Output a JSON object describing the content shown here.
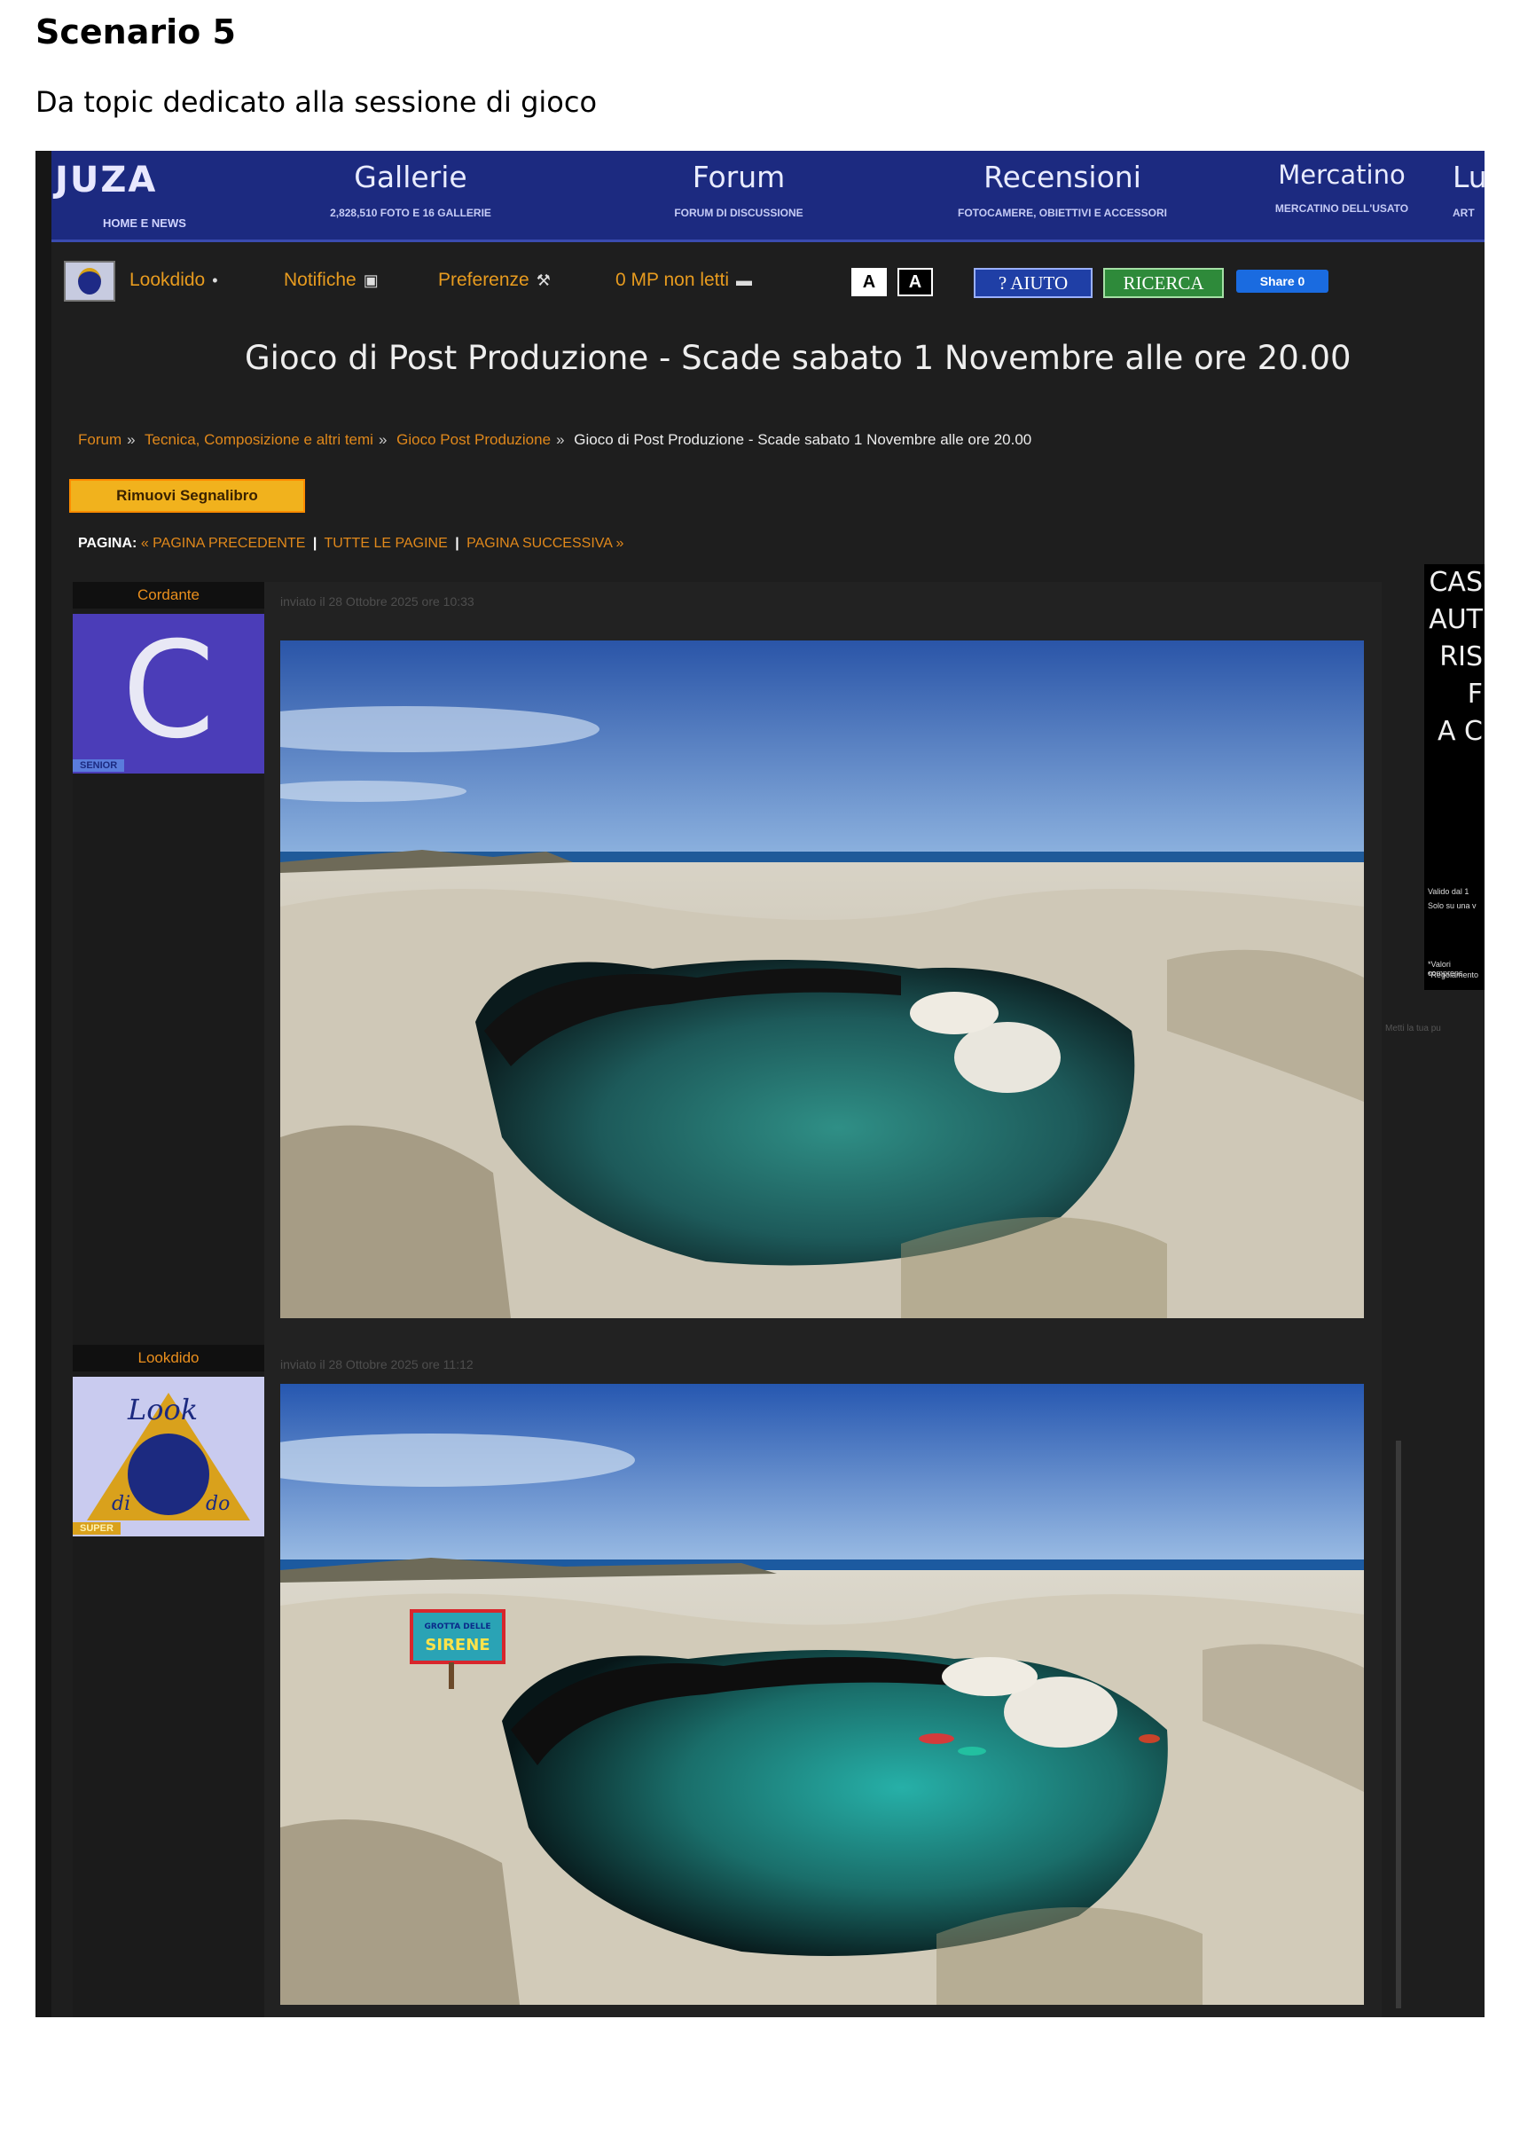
{
  "document": {
    "title": "Scenario 5",
    "subtitle": "Da topic dedicato alla sessione di gioco"
  },
  "site": {
    "logo_text": "JUZA",
    "logo_sub": "HOME E NEWS",
    "nav": [
      {
        "label": "Gallerie",
        "desc": "2,828,510 FOTO E 16 GALLERIE"
      },
      {
        "label": "Forum",
        "desc": "FORUM DI DISCUSSIONE"
      },
      {
        "label": "Recensioni",
        "desc": "FOTOCAMERE, OBIETTIVI E ACCESSORI"
      },
      {
        "label": "Mercatino",
        "desc": "MERCATINO DELL'USATO"
      },
      {
        "label": "Lu",
        "desc": "ART"
      }
    ]
  },
  "userbar": {
    "username": "Lookdido",
    "notifications": "Notifiche",
    "preferences": "Preferenze",
    "messages": "0 MP non letti",
    "font_small": "A",
    "font_large": "A",
    "help": "? AIUTO",
    "search": "RICERCA",
    "share": "Share 0"
  },
  "topic": {
    "title": "Gioco di Post Produzione - Scade sabato 1 Novembre alle ore 20.00",
    "breadcrumb": [
      "Forum",
      "Tecnica, Composizione e altri temi",
      "Gioco Post Produzione",
      "Gioco di Post Produzione - Scade sabato 1 Novembre alle ore 20.00"
    ],
    "bookmark_button": "Rimuovi Segnalibro",
    "pager": {
      "label": "PAGINA:",
      "prev": "« PAGINA PRECEDENTE",
      "all": "TUTTE LE PAGINE",
      "next": "PAGINA SUCCESSIVA »"
    }
  },
  "posts": [
    {
      "author": "Cordante",
      "avatar_letter": "C",
      "rank": "SENIOR",
      "date": "inviato il 28 Ottobre 2025 ore 10:33"
    },
    {
      "author": "Lookdido",
      "avatar_text": "Look",
      "avatar_letters": [
        "di",
        "do"
      ],
      "rank": "SUPER",
      "date": "inviato il 28 Ottobre 2025 ore 11:12",
      "sign_text": [
        "GROTTA DELLE",
        "SIRENE"
      ]
    }
  ],
  "sidebar_ad": {
    "lines": [
      "CAS",
      "AUT",
      "RIS",
      "F",
      "A C"
    ],
    "small": [
      "Valido dal 1",
      "Solo su una v",
      "*Valori comprens",
      "*Regolamento"
    ],
    "caption": "Metti la tua pu"
  },
  "colors": {
    "nav_bg": "#1c2a80",
    "link_orange": "#e0881b",
    "page_bg": "#1e1e1e",
    "bookmark_yellow": "#f1b21d"
  }
}
